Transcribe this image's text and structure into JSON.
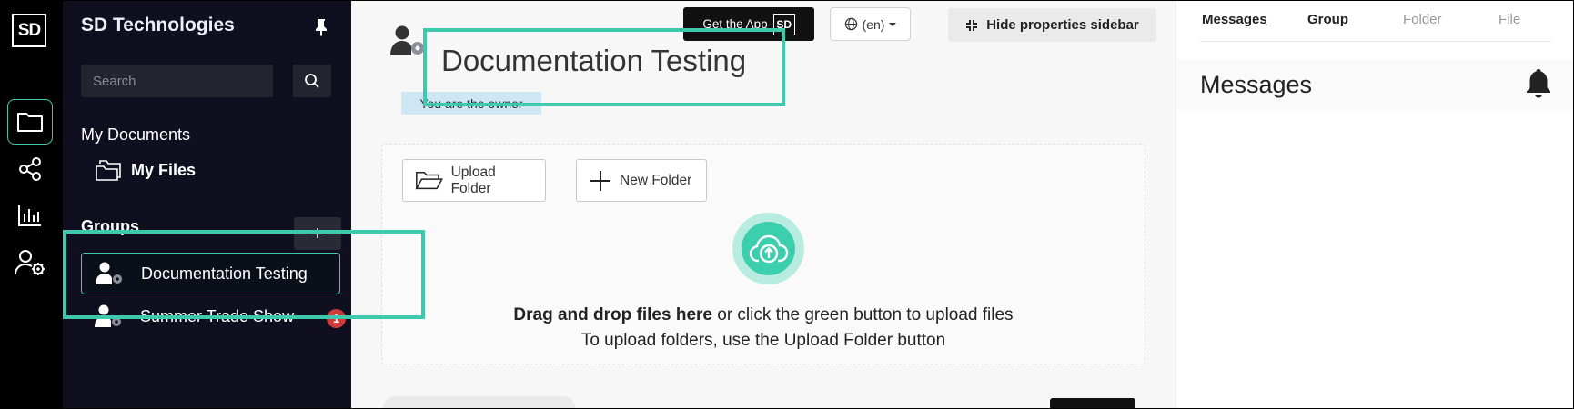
{
  "app": {
    "logo_text": "SD",
    "org_name": "SD Technologies"
  },
  "rail": {
    "items": [
      {
        "name": "folder-icon",
        "active": true
      },
      {
        "name": "share-icon",
        "active": false
      },
      {
        "name": "chart-icon",
        "active": false
      },
      {
        "name": "user-settings-icon",
        "active": false
      }
    ]
  },
  "sidebar": {
    "search_placeholder": "Search",
    "my_documents_label": "My Documents",
    "my_files_label": "My Files",
    "groups_label": "Groups",
    "add_group_label": "+",
    "groups": [
      {
        "label": "Documentation Testing",
        "active": true
      },
      {
        "label": "Summer Trade Show",
        "badge": "1"
      }
    ]
  },
  "topbar": {
    "get_app_label": "Get the App",
    "get_app_logo": "SD",
    "language_label": "(en)",
    "hide_sidebar_label": "Hide properties sidebar"
  },
  "main": {
    "title": "Documentation Testing",
    "owner_badge": "You are the owner",
    "upload_folder_label": "Upload Folder",
    "new_folder_label": "New Folder",
    "drop_bold": "Drag and drop files here",
    "drop_rest": " or click the green button to upload files",
    "drop_line2": "To upload folders, use the Upload Folder button"
  },
  "right_panel": {
    "tabs": [
      "Messages",
      "Group",
      "Folder",
      "File"
    ],
    "messages_title": "Messages"
  },
  "colors": {
    "accent": "#3ec9ad",
    "sidebar_bg": "#0f0f1f",
    "upload_green": "#3ccfae",
    "badge_red": "#d23a3a"
  }
}
